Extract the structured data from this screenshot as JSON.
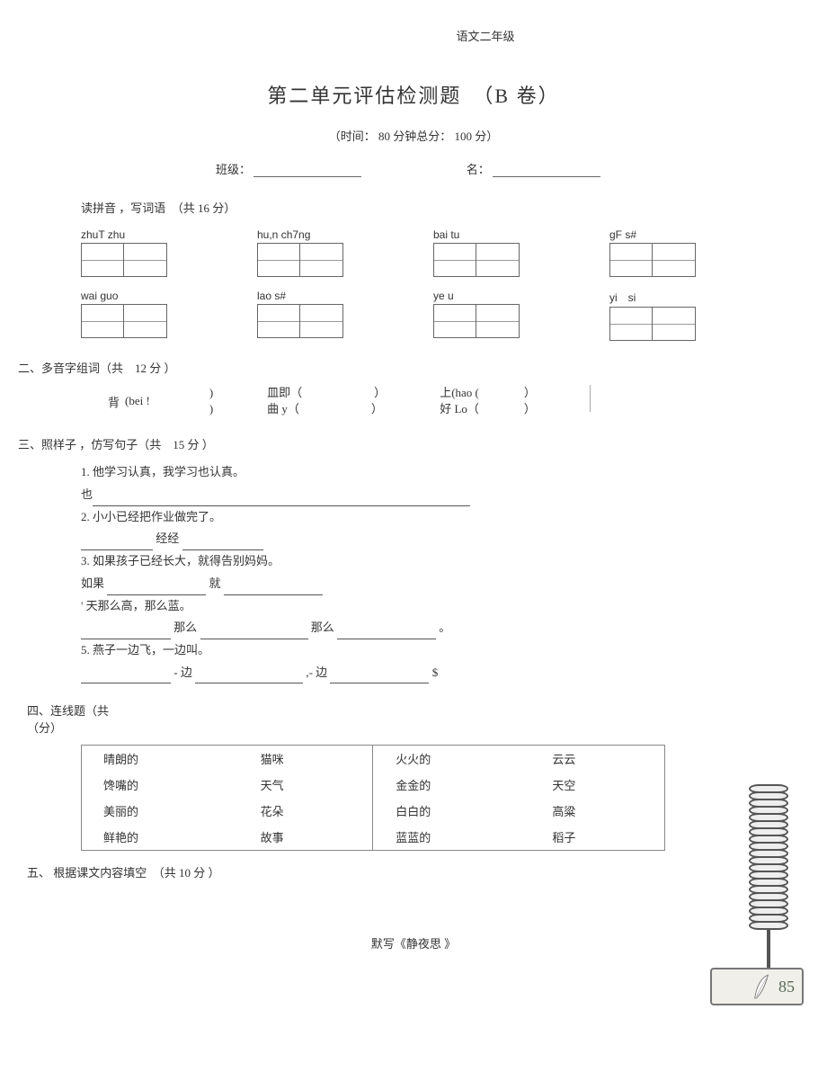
{
  "header_top": "语文二年级",
  "title": "第二单元评估检测题　（B 卷）",
  "subtitle": "（时间：  80 分钟总分：  100 分）",
  "fields": {
    "class_label": "班级：",
    "name_label": "名："
  },
  "sections": {
    "s1": {
      "label": "读拼音  ，写词语　（共  16 分）"
    },
    "s2": {
      "label": "二、多音字组词（共　12 分 ）"
    },
    "s3": {
      "label": "三、照样子  ，仿写句子（共　15 分 ）"
    },
    "s4": {
      "label_a": "四、连线题（共",
      "label_b": "（分）"
    },
    "s5": {
      "label": "五、 根据课文内容填空　（共  10 分 ）"
    }
  },
  "pinyin_rows": [
    [
      "zhuT zhu",
      "hu,n ch7ng",
      "bai tu",
      "gF s#"
    ],
    [
      "wai guo",
      "lao s#",
      "ye u",
      "yi　si"
    ]
  ],
  "q2": {
    "g1_char": "背",
    "g1_a": "(bei !",
    "g1_b": ")",
    "g1_c": ")",
    "g2_a": "皿即（",
    "g2_b": "曲 y（",
    "g2_c": "）",
    "g3_a": "上(hao (",
    "g3_b": "好 Lo（",
    "g3_c": "）"
  },
  "q3": {
    "l1": "1.    他学习认真，我学习也认真。",
    "l1b_pre": "也",
    "l2": "2.    小小已经把作业做完了。",
    "l2b_mid": "经经",
    "l3": "3.    如果孩子已经长大，就得告别妈妈。",
    "l3b_pre": "如果",
    "l3b_mid": "就",
    "l4": "'    天那么高，那么蓝。",
    "l4b_a": "那么",
    "l4b_b": "那么",
    "l4b_end": "。",
    "l5": "5.  燕子一边飞，一边叫。",
    "l5b_a": "- 边",
    "l5b_b": ",-  边",
    "l5b_end": "$"
  },
  "q4": {
    "left": [
      [
        "晴朗的",
        "猫咪"
      ],
      [
        "馋嘴的",
        "天气"
      ],
      [
        "美丽的",
        "花朵"
      ],
      [
        "鲜艳的",
        "故事"
      ]
    ],
    "right": [
      [
        "火火的",
        "云云"
      ],
      [
        "金金的",
        "天空"
      ],
      [
        "白白的",
        "高粱"
      ],
      [
        "蓝蓝的",
        "稻子"
      ]
    ]
  },
  "bottom_caption": "默写《静夜思   》",
  "page_number": "85"
}
